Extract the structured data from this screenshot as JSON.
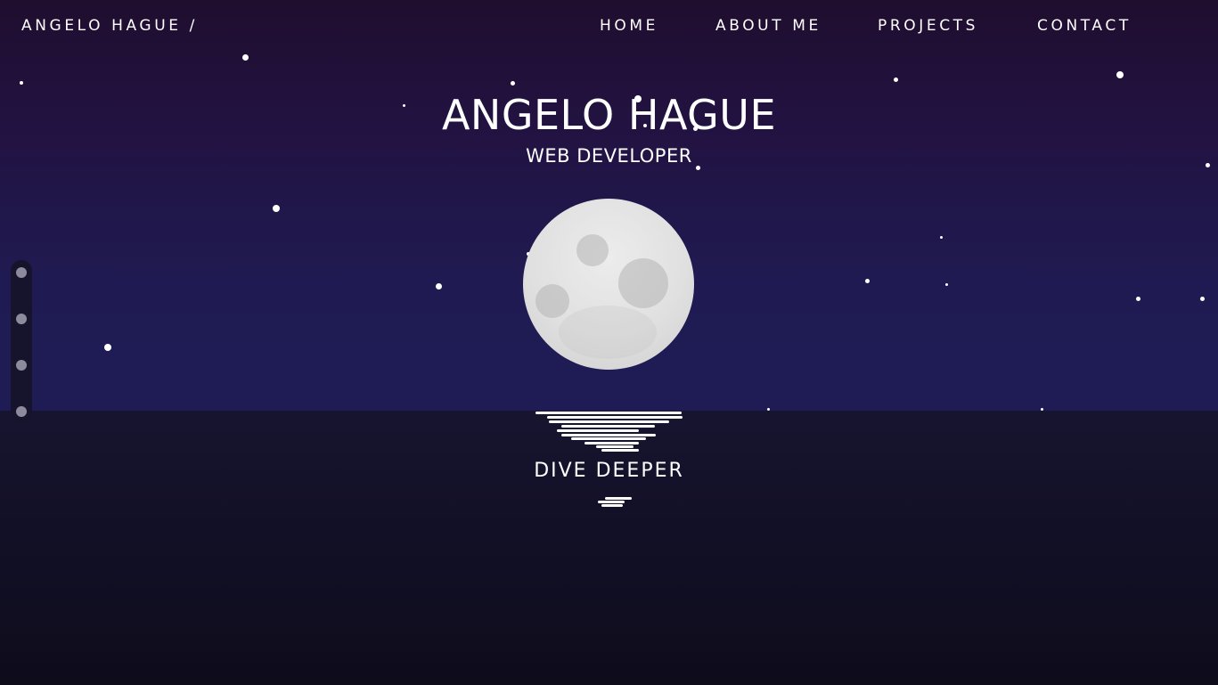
{
  "header": {
    "brand": "ANGELO HAGUE /",
    "nav": [
      {
        "label": "HOME"
      },
      {
        "label": "ABOUT ME"
      },
      {
        "label": "PROJECTS"
      },
      {
        "label": "CONTACT"
      }
    ]
  },
  "hero": {
    "title": "ANGELO HAGUE",
    "subtitle": "WEB DEVELOPER",
    "cta": "DIVE DEEPER"
  },
  "section_nav": {
    "count": 4
  },
  "colors": {
    "sky_top": "#1f0e2e",
    "sky_bottom": "#1f1b55",
    "sea": "#121026",
    "moon": "#e0e0e0",
    "text": "#ffffff",
    "dot": "#8e8a9e"
  }
}
